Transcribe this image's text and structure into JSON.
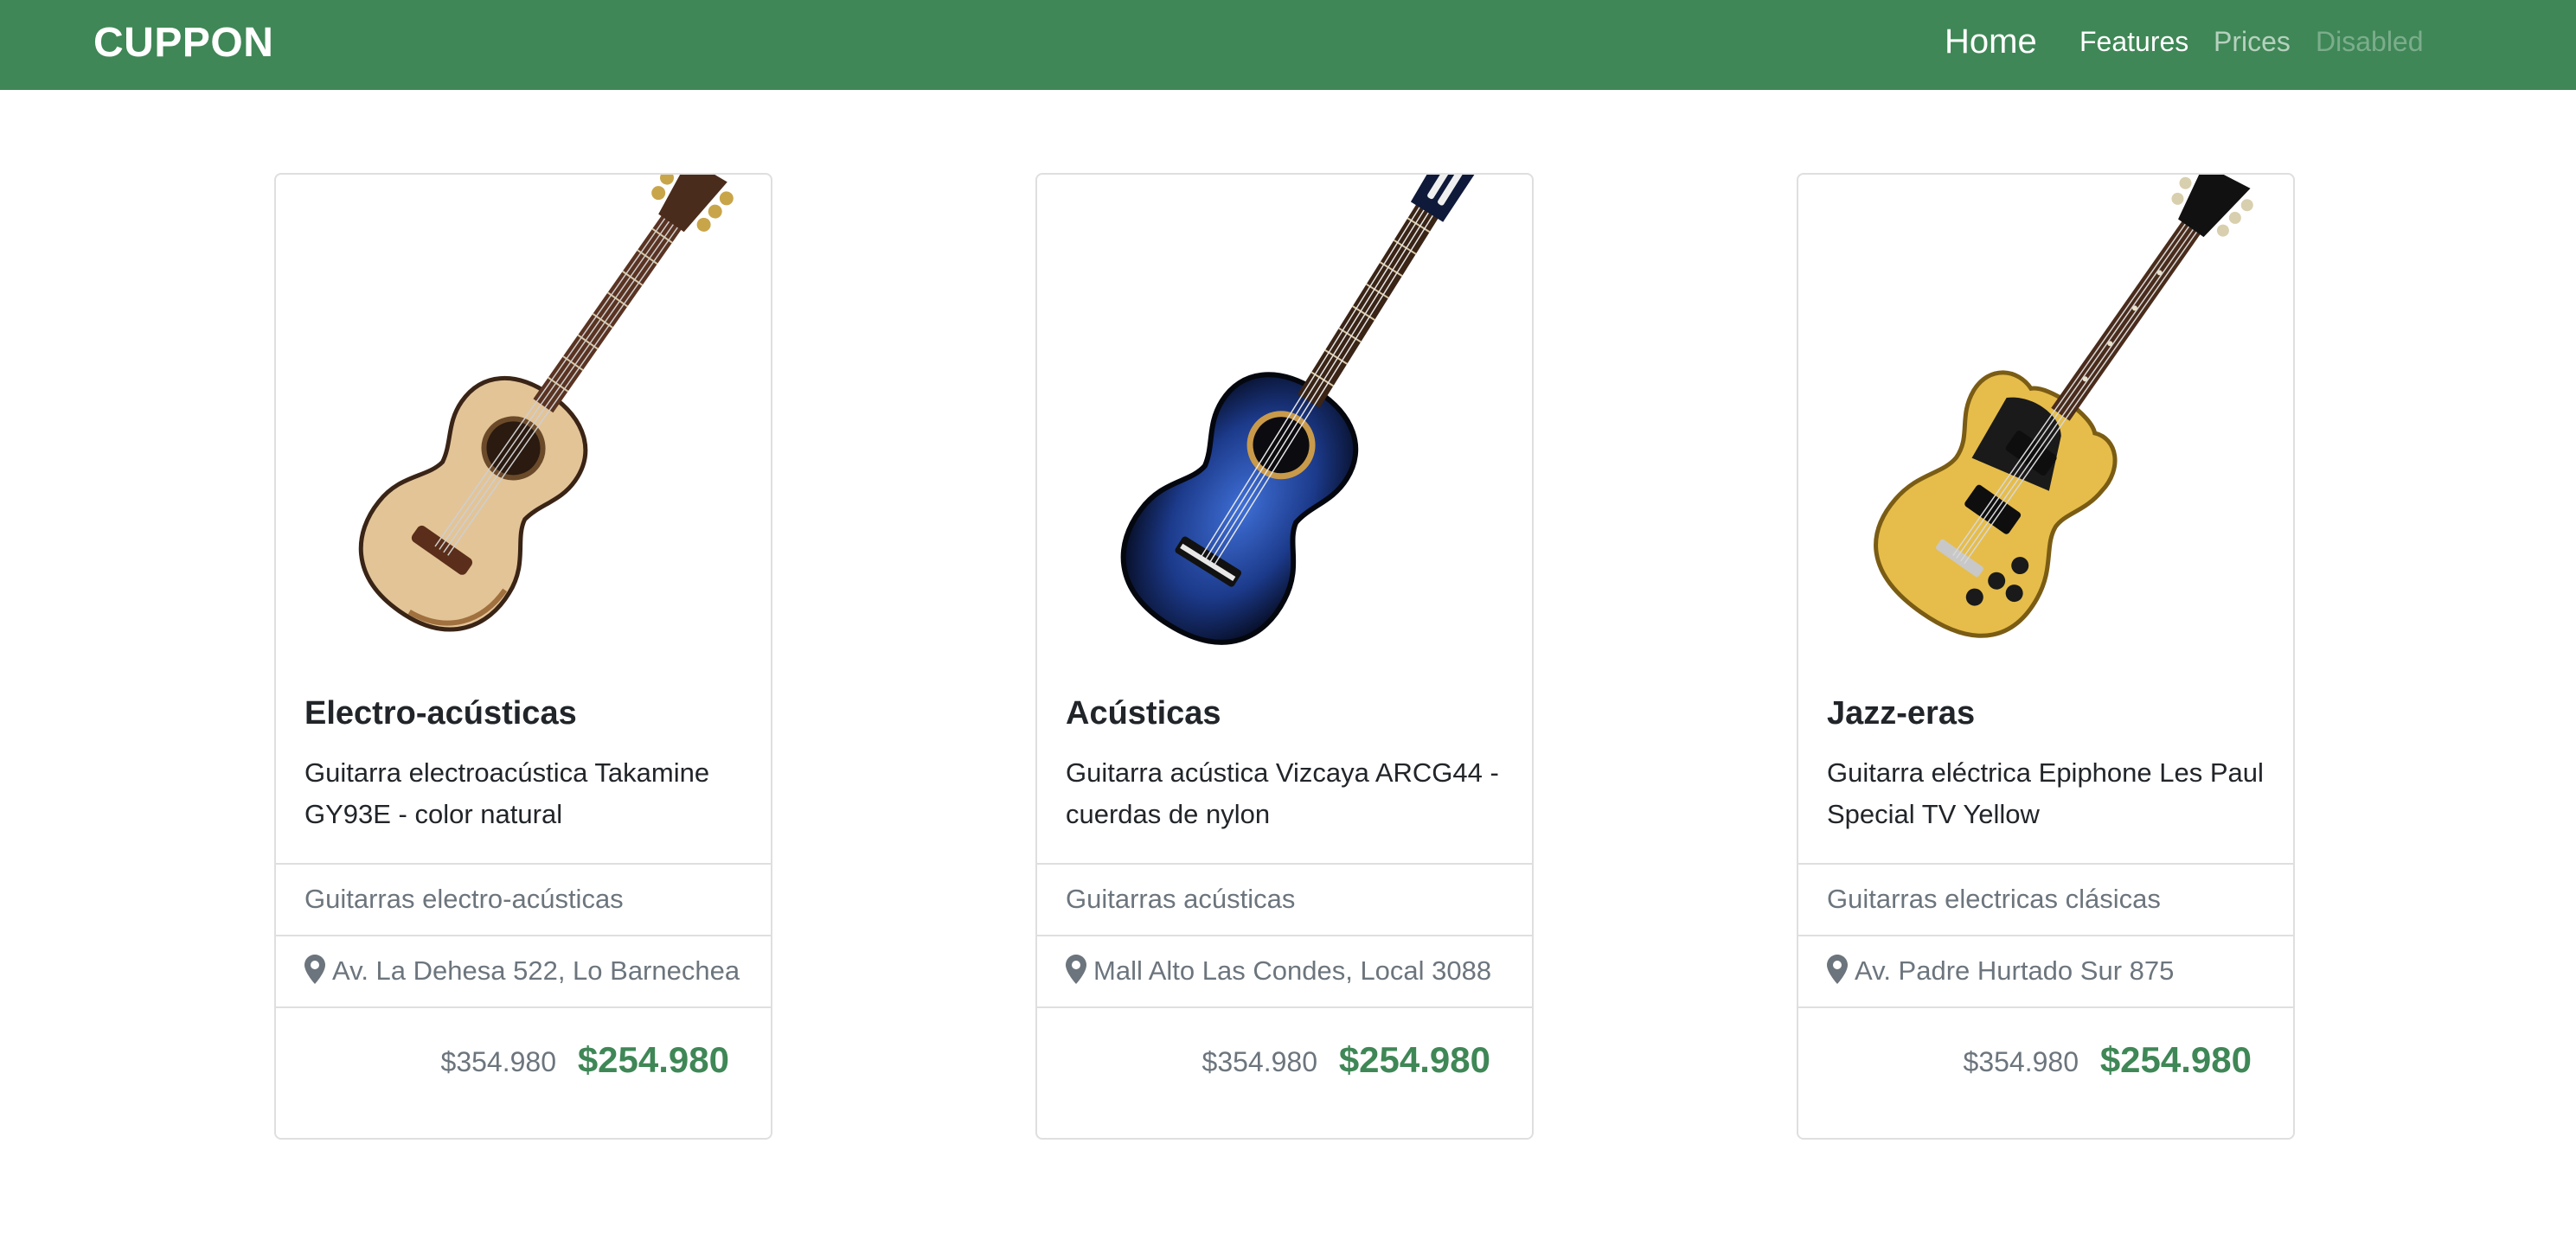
{
  "navbar": {
    "brand": "CUPPON",
    "links": [
      {
        "label": "Home"
      },
      {
        "label": "Features"
      },
      {
        "label": "Prices"
      },
      {
        "label": "Disabled"
      }
    ]
  },
  "cards": [
    {
      "title": "Electro-acústicas",
      "description": "Guitarra electroacústica Takamine GY93E - color natural",
      "category": "Guitarras electro-acústicas",
      "location": "Av. La Dehesa 522, Lo Barnechea",
      "old_price": "$354.980",
      "price": "$254.980",
      "image_icon": "acoustic-guitar-natural"
    },
    {
      "title": "Acústicas",
      "description": "Guitarra acústica Vizcaya ARCG44 - cuerdas de nylon",
      "category": "Guitarras acústicas",
      "location": "Mall Alto Las Condes, Local 3088",
      "old_price": "$354.980",
      "price": "$254.980",
      "image_icon": "classical-guitar-blue"
    },
    {
      "title": "Jazz-eras",
      "description": "Guitarra eléctrica Epiphone Les Paul Special TV Yellow",
      "category": "Guitarras electricas clásicas",
      "location": "Av. Padre Hurtado Sur 875",
      "old_price": "$354.980",
      "price": "$254.980",
      "image_icon": "electric-guitar-yellow"
    }
  ],
  "colors": {
    "navbar": "#3f8756",
    "price": "#3f8756",
    "muted": "#6c757d"
  }
}
